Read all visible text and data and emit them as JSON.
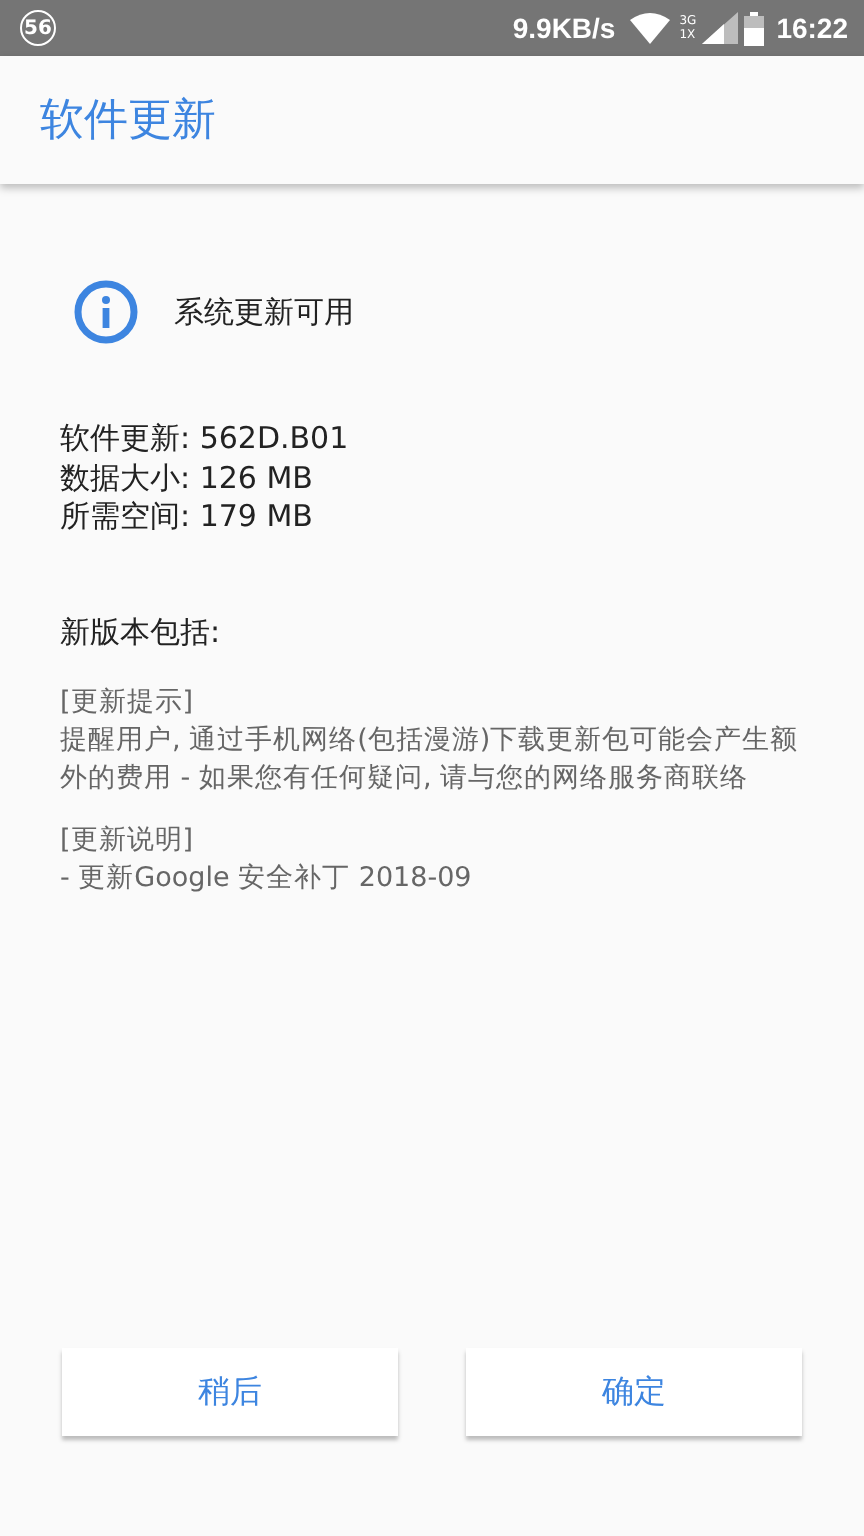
{
  "status_bar": {
    "badge": "56",
    "speed": "9.9KB/s",
    "network_top": "3G",
    "network_bottom": "1X",
    "time": "16:22"
  },
  "app_bar": {
    "title": "软件更新"
  },
  "notice": {
    "text": "系统更新可用"
  },
  "details": [
    "软件更新: 562D.B01",
    "数据大小: 126 MB",
    "所需空间: 179 MB"
  ],
  "changelog": {
    "heading": "新版本包括:",
    "sections": [
      {
        "title": "[更新提示]",
        "lines": [
          "提醒用户, 通过手机网络(包括漫游)下载更新包可能会产生额外的费用 - 如果您有任何疑问, 请与您的网络服务商联络"
        ]
      },
      {
        "title": "[更新说明]",
        "lines": [
          "- 更新Google 安全补丁 2018-09"
        ]
      }
    ]
  },
  "buttons": [
    {
      "label": "稍后"
    },
    {
      "label": "确定"
    }
  ]
}
